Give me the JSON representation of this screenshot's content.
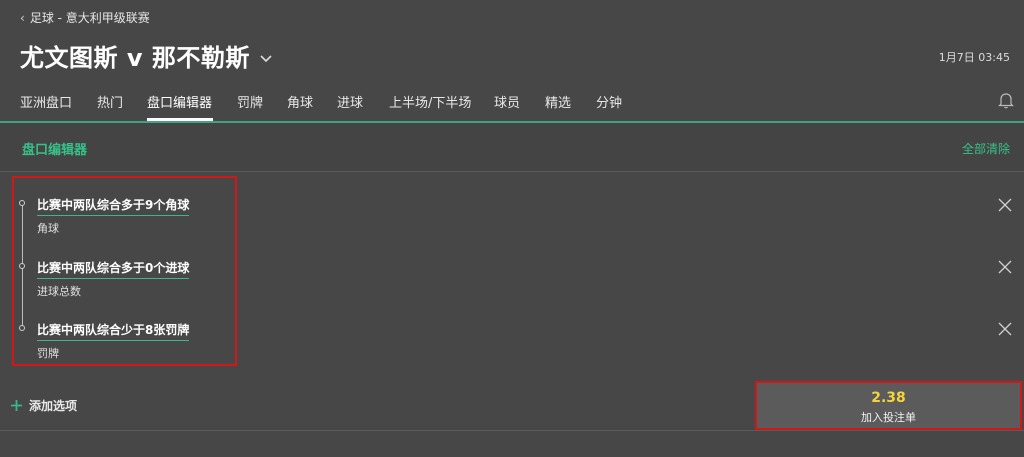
{
  "breadcrumb": {
    "text": "足球 - 意大利甲级联赛"
  },
  "match": {
    "title": "尤文图斯 v 那不勒斯",
    "datetime": "1月7日 03:45"
  },
  "tabs": [
    {
      "label": "亚洲盘口"
    },
    {
      "label": "热门"
    },
    {
      "label": "盘口编辑器"
    },
    {
      "label": "罚牌"
    },
    {
      "label": "角球"
    },
    {
      "label": "进球"
    },
    {
      "label": "上半场/下半场"
    },
    {
      "label": "球员"
    },
    {
      "label": "精选"
    },
    {
      "label": "分钟"
    }
  ],
  "active_tab": "盘口编辑器",
  "editor": {
    "title": "盘口编辑器",
    "clear_all": "全部清除"
  },
  "selections": [
    {
      "name": "比赛中两队综合多于9个角球",
      "market": "角球"
    },
    {
      "name": "比赛中两队综合多于0个进球",
      "market": "进球总数"
    },
    {
      "name": "比赛中两队综合少于8张罚牌",
      "market": "罚牌"
    }
  ],
  "add_option": {
    "label": "添加选项"
  },
  "betslip": {
    "odds": "2.38",
    "label": "加入投注单"
  },
  "colors": {
    "accent": "#3fb58a",
    "odds": "#f5d33b",
    "highlight": "#d01818",
    "background": "#474747"
  },
  "icons": {
    "back": "chevron-left-icon",
    "title_dropdown": "chevron-down-icon",
    "notifications": "bell-icon",
    "remove": "close-icon",
    "add": "plus-icon"
  }
}
